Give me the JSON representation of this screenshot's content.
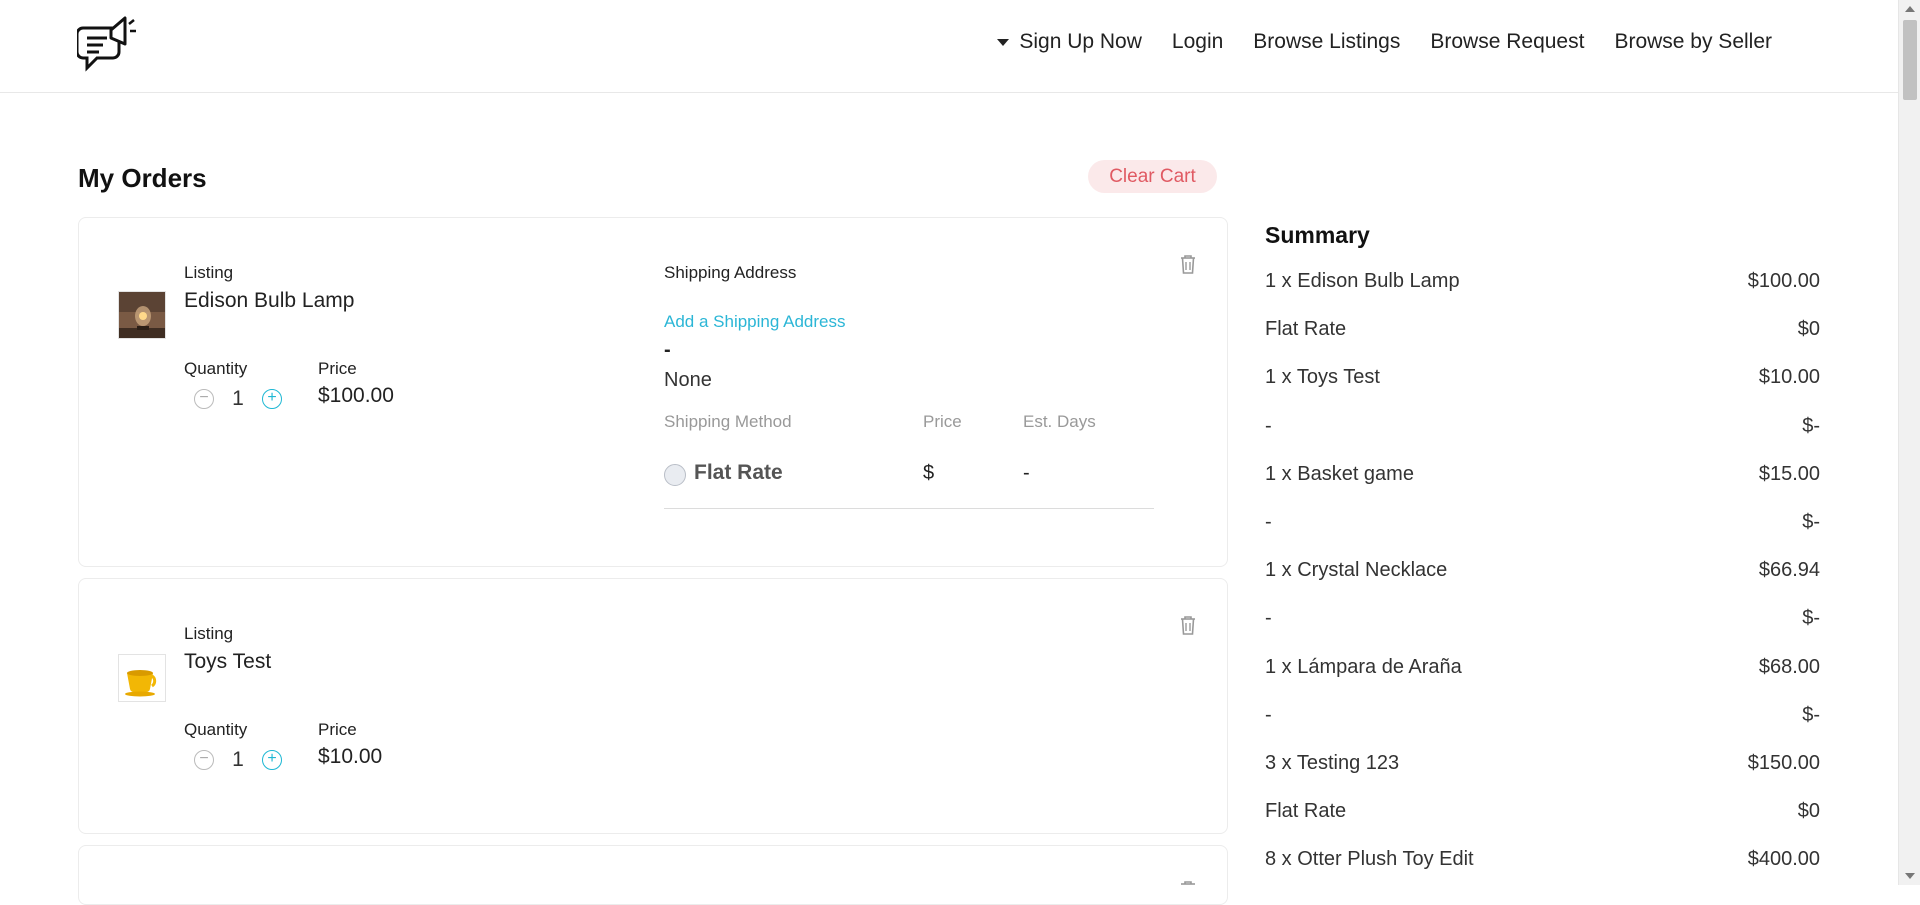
{
  "header": {
    "nav": [
      "Sign Up Now",
      "Login",
      "Browse Listings",
      "Browse Request",
      "Browse by Seller"
    ]
  },
  "orders": {
    "title": "My Orders",
    "clear_cart_label": "Clear Cart",
    "items": [
      {
        "listing_label": "Listing",
        "name": "Edison Bulb Lamp",
        "quantity_label": "Quantity",
        "quantity": "1",
        "price_label": "Price",
        "price": "$100.00",
        "image_icon": "lamp-image",
        "shipping": {
          "title": "Shipping Address",
          "add_link": "Add a Shipping Address",
          "dash": "-",
          "address": "None",
          "method_header": "Shipping Method",
          "price_header": "Price",
          "days_header": "Est. Days",
          "method": "Flat Rate",
          "price": "$",
          "days": "-"
        }
      },
      {
        "listing_label": "Listing",
        "name": "Toys Test",
        "quantity_label": "Quantity",
        "quantity": "1",
        "price_label": "Price",
        "price": "$10.00",
        "image_icon": "yellow-cup-image"
      }
    ]
  },
  "summary": {
    "title": "Summary",
    "rows": [
      {
        "label": "1 x Edison Bulb Lamp",
        "value": "$100.00"
      },
      {
        "label": "Flat Rate",
        "value": "$0"
      },
      {
        "label": "1 x Toys Test",
        "value": "$10.00"
      },
      {
        "label": "-",
        "value": "$-"
      },
      {
        "label": "1 x Basket game",
        "value": "$15.00"
      },
      {
        "label": "-",
        "value": "$-"
      },
      {
        "label": "1 x Crystal Necklace",
        "value": "$66.94"
      },
      {
        "label": "-",
        "value": "$-"
      },
      {
        "label": "1 x Lámpara de Araña",
        "value": "$68.00"
      },
      {
        "label": "-",
        "value": "$-"
      },
      {
        "label": "3 x Testing 123",
        "value": "$150.00"
      },
      {
        "label": "Flat Rate",
        "value": "$0"
      },
      {
        "label": "8 x Otter Plush Toy Edit",
        "value": "$400.00"
      }
    ]
  },
  "colors": {
    "accent": "#2bb6d6",
    "clear_cart_bg": "#fbe9ea",
    "clear_cart_text": "#e05a63"
  }
}
